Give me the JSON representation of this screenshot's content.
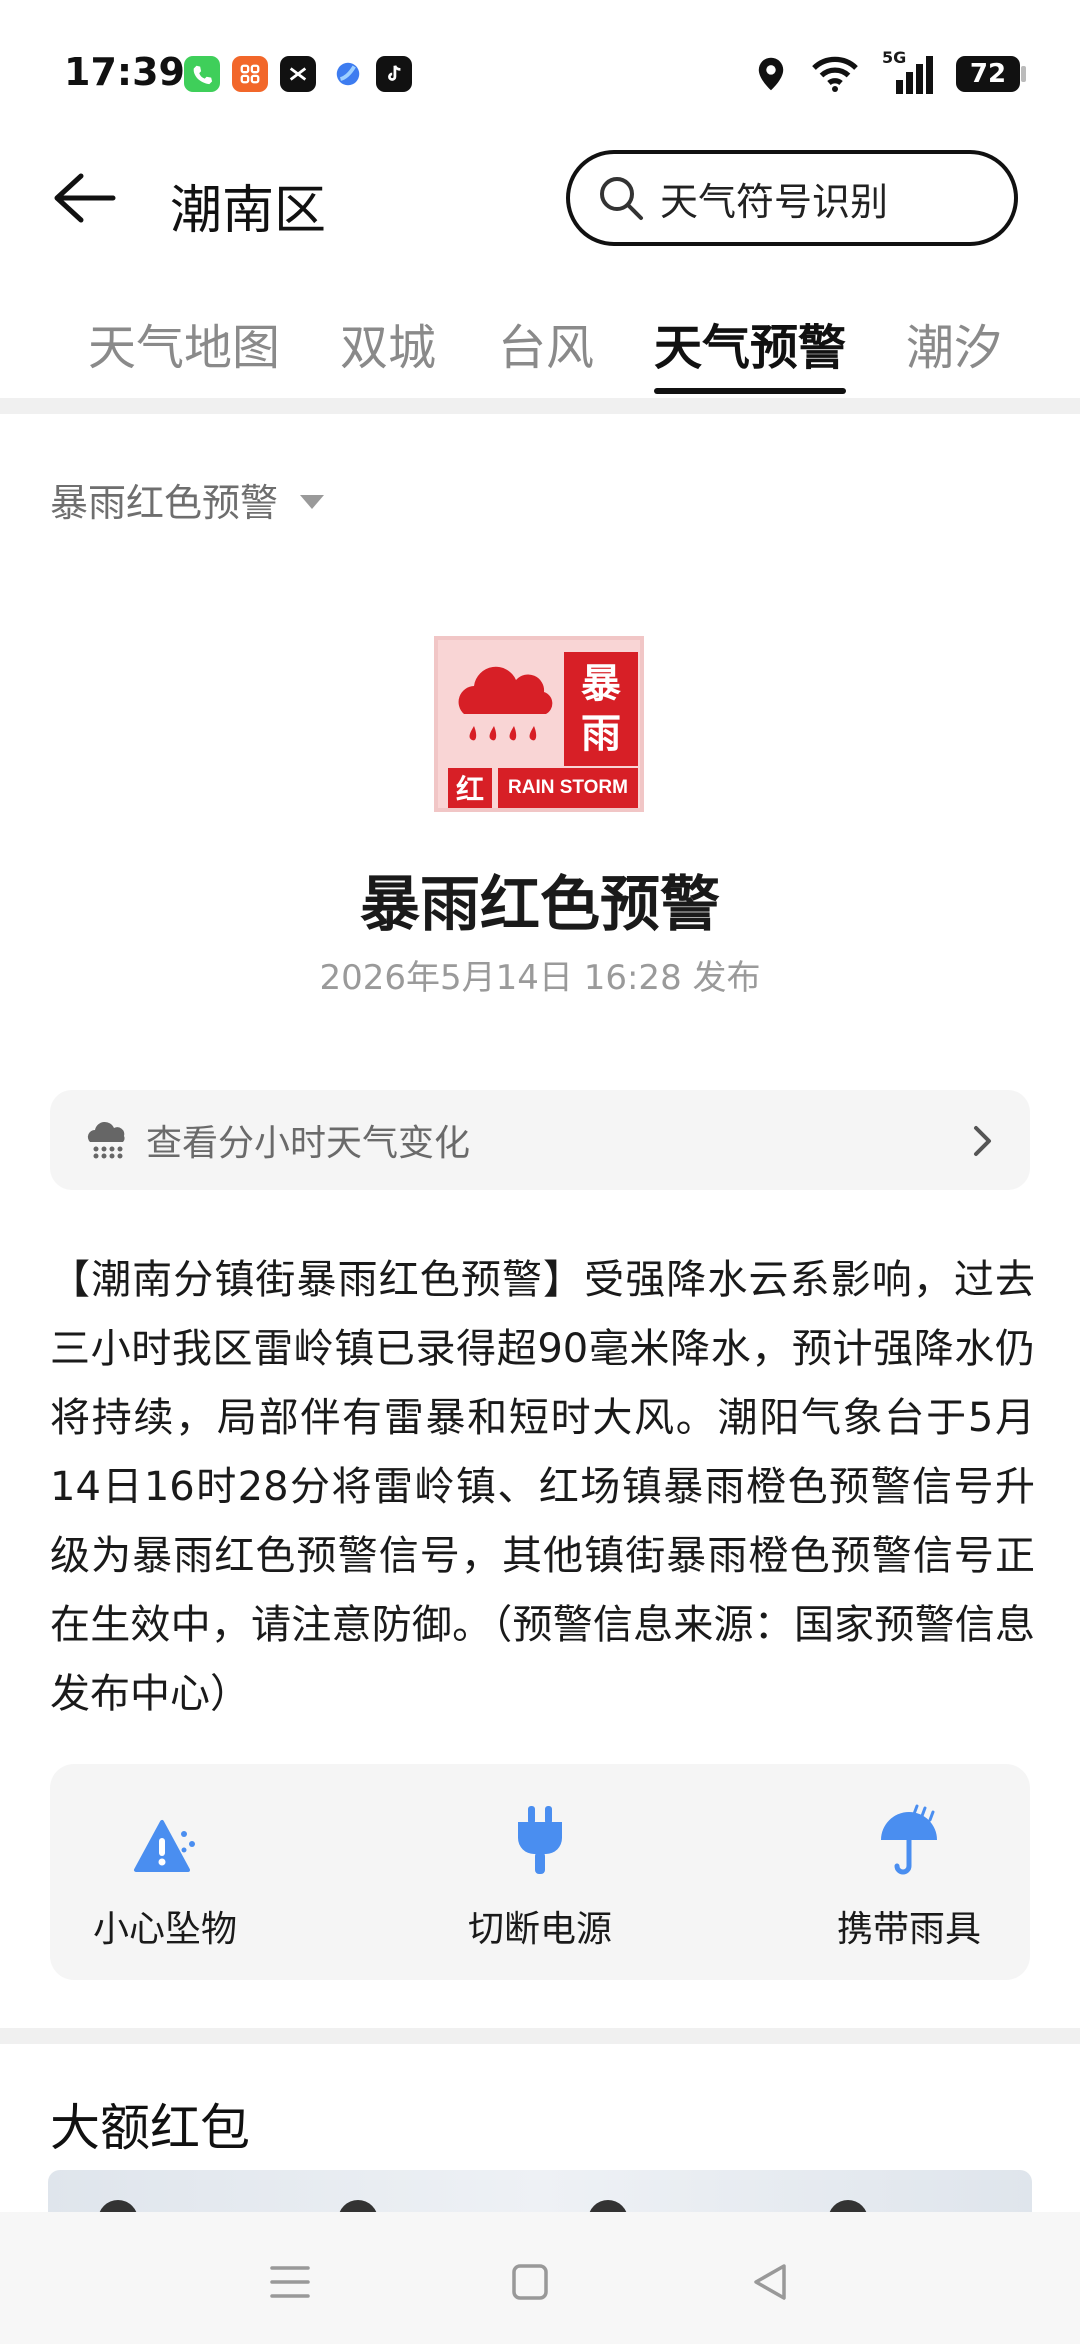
{
  "status_bar": {
    "time": "17:39",
    "battery": "72",
    "network": "5G"
  },
  "header": {
    "title": "潮南区",
    "search_label": "天气符号识别"
  },
  "tabs": [
    {
      "label": "天气地图"
    },
    {
      "label": "双城"
    },
    {
      "label": "台风"
    },
    {
      "label": "天气预警",
      "active": true
    },
    {
      "label": "潮汐"
    }
  ],
  "filter": {
    "selected": "暴雨红色预警"
  },
  "badge": {
    "char_top": "暴",
    "char_bottom": "雨",
    "level_char": "红",
    "label": "RAIN STORM",
    "color": "#d71f26"
  },
  "alert": {
    "title": "暴雨红色预警",
    "published": "2026年5月14日 16:28 发布",
    "hourly_link": "查看分小时天气变化",
    "description": "【潮南分镇街暴雨红色预警】受强降水云系影响，过去三小时我区雷岭镇已录得超90毫米降水，预计强降水仍将持续，局部伴有雷暴和短时大风。潮阳气象台于5月14日16时28分将雷岭镇、红场镇暴雨橙色预警信号升级为暴雨红色预警信号，其他镇街暴雨橙色预警信号正在生效中，请注意防御。（预警信息来源：国家预警信息发布中心）"
  },
  "tips": [
    {
      "label": "小心坠物",
      "icon": "falling-object-warning-icon"
    },
    {
      "label": "切断电源",
      "icon": "power-plug-icon"
    },
    {
      "label": "携带雨具",
      "icon": "umbrella-icon"
    }
  ],
  "section": {
    "title": "大额红包"
  },
  "colors": {
    "accent_blue": "#4a8ef0",
    "alert_red": "#d71f26"
  }
}
